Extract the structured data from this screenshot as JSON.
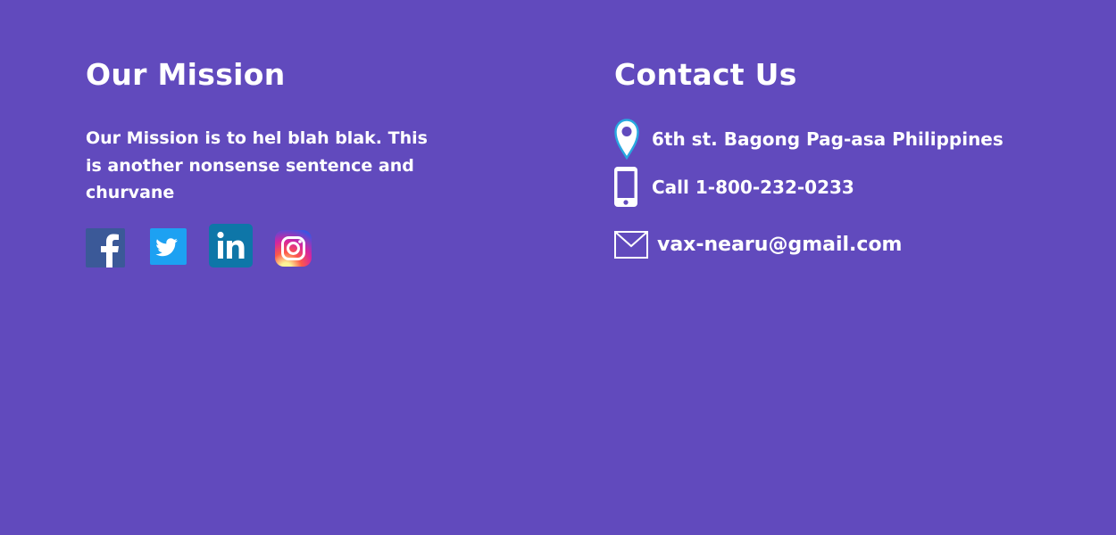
{
  "mission": {
    "heading": "Our Mission",
    "text": "Our Mission is to hel blah blak. This is another  nonsense sentence and churvane",
    "socials": [
      {
        "icon": "facebook-icon",
        "color": "#3b5998"
      },
      {
        "icon": "twitter-icon",
        "color": "#1da1f2"
      },
      {
        "icon": "linkedin-icon",
        "color": "#0e76a8"
      },
      {
        "icon": "instagram-icon",
        "color": "#c13584"
      }
    ]
  },
  "contact": {
    "heading": "Contact Us",
    "address": "6th st. Bagong Pag-asa Philippines",
    "phone": "Call 1-800-232-0233",
    "email": "vax-nearu@gmail.com",
    "icons": {
      "address": "location-pin-icon",
      "phone": "mobile-phone-icon",
      "email": "envelope-icon"
    }
  },
  "colors": {
    "background": "#614abd",
    "text": "#ffffff",
    "pin_accent": "#29a8e0"
  }
}
